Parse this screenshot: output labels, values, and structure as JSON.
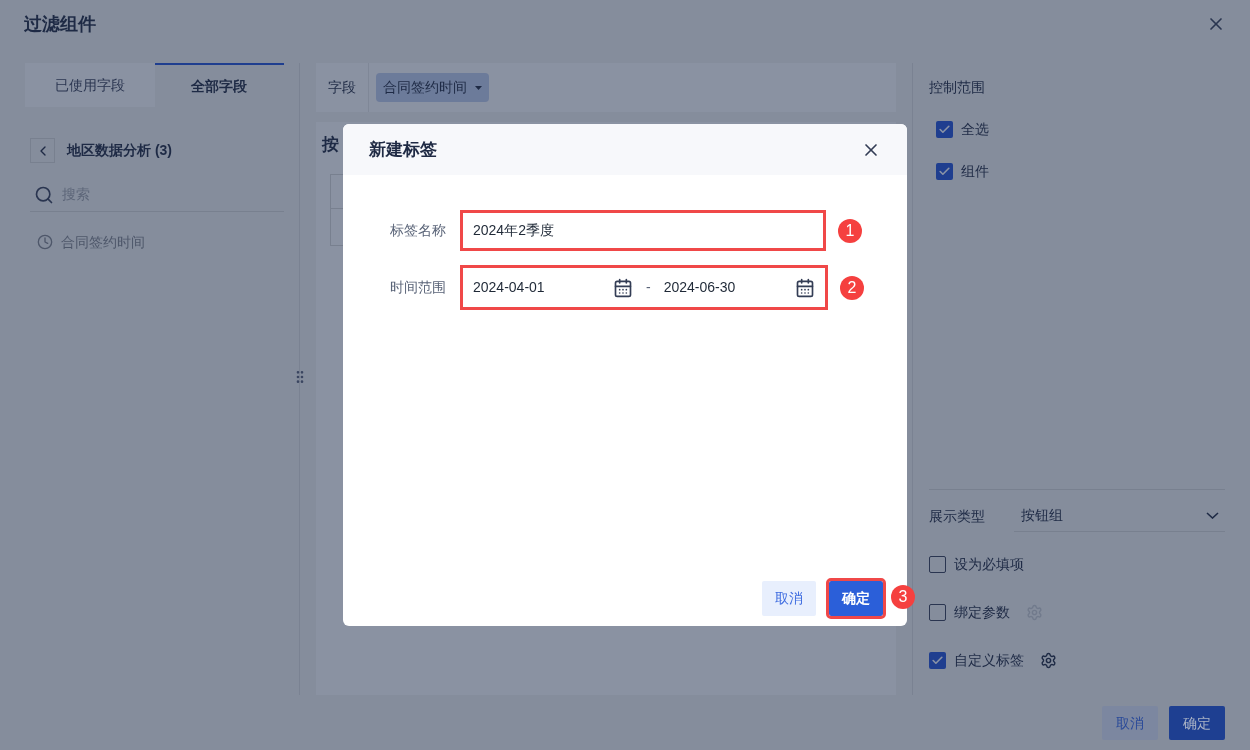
{
  "window": {
    "title": "过滤组件"
  },
  "field_tabs": [
    {
      "label": "已使用字段",
      "selected": false
    },
    {
      "label": "全部字段",
      "selected": true
    }
  ],
  "dataset": {
    "title": "地区数据分析 (3)"
  },
  "search": {
    "placeholder": "搜索"
  },
  "fields": [
    {
      "label": "合同签约时间",
      "disabled": true
    }
  ],
  "field_bar": {
    "label": "字段",
    "value": "合同签约时间"
  },
  "content": {
    "title": "按"
  },
  "control_range": {
    "title": "控制范围",
    "items": [
      {
        "label": "全选",
        "checked": true
      },
      {
        "label": "组件",
        "checked": true
      }
    ]
  },
  "display_type": {
    "label": "展示类型",
    "value": "按钮组"
  },
  "options": [
    {
      "label": "设为必填项",
      "checked": false,
      "settings": false
    },
    {
      "label": "绑定参数",
      "checked": false,
      "settings": true
    },
    {
      "label": "自定义标签",
      "checked": true,
      "settings": true
    }
  ],
  "buttons": [
    {
      "label": "取消",
      "kind": "secondary"
    },
    {
      "label": "确定",
      "kind": "primary"
    }
  ],
  "dialog": {
    "title": "新建标签",
    "fields": [
      {
        "kind": "text",
        "label": "标签名称",
        "value": "2024年2季度",
        "step": "1"
      },
      {
        "kind": "range",
        "label": "时间范围",
        "start": "2024-04-01",
        "separator": "-",
        "end": "2024-06-30",
        "step": "2"
      }
    ],
    "buttons": [
      {
        "label": "取消",
        "kind": "secondary"
      },
      {
        "label": "确定",
        "kind": "primary",
        "step": "3"
      }
    ]
  }
}
